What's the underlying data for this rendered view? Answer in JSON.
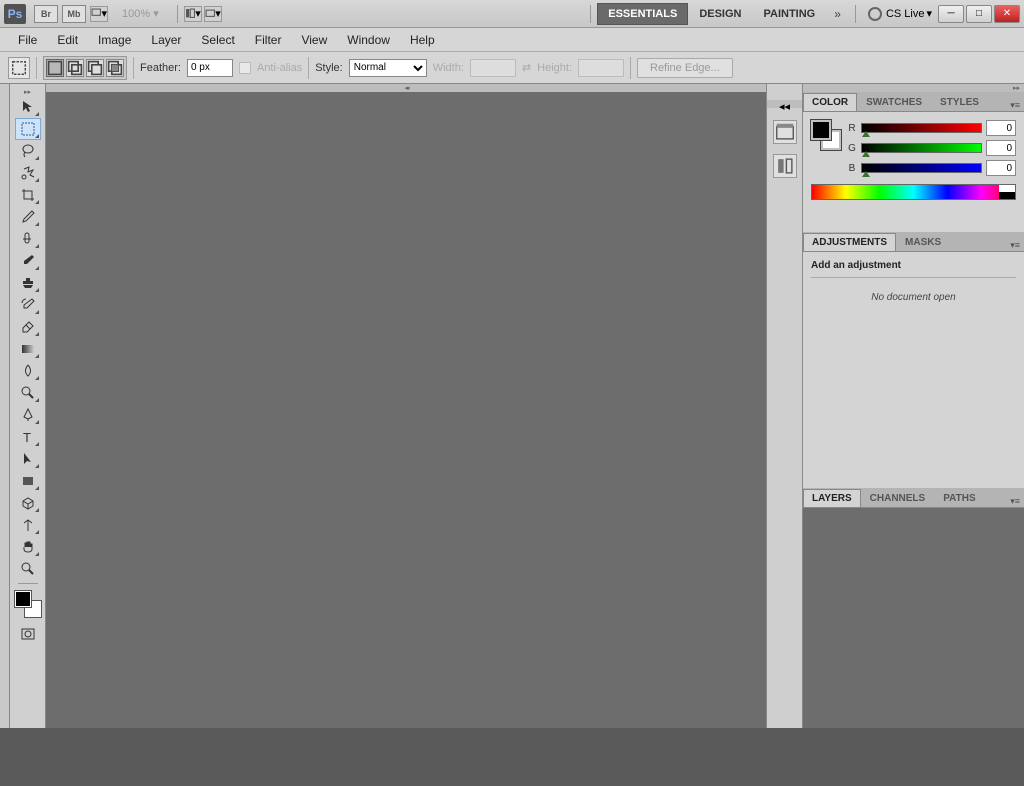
{
  "app": {
    "logo": "Ps",
    "br": "Br",
    "mb": "Mb",
    "zoom": "100%"
  },
  "workspaces": {
    "essentials": "ESSENTIALS",
    "design": "DESIGN",
    "painting": "PAINTING"
  },
  "cslive": "CS Live",
  "menu": {
    "file": "File",
    "edit": "Edit",
    "image": "Image",
    "layer": "Layer",
    "select": "Select",
    "filter": "Filter",
    "view": "View",
    "window": "Window",
    "help": "Help"
  },
  "options": {
    "feather_label": "Feather:",
    "feather_value": "0 px",
    "antialias": "Anti-alias",
    "style_label": "Style:",
    "style_value": "Normal",
    "width_label": "Width:",
    "height_label": "Height:",
    "refine": "Refine Edge..."
  },
  "color_panel": {
    "tabs": {
      "color": "COLOR",
      "swatches": "SWATCHES",
      "styles": "STYLES"
    },
    "r": "R",
    "g": "G",
    "b": "B",
    "r_val": "0",
    "g_val": "0",
    "b_val": "0"
  },
  "adjust_panel": {
    "tabs": {
      "adjustments": "ADJUSTMENTS",
      "masks": "MASKS"
    },
    "title": "Add an adjustment",
    "no_doc": "No document open"
  },
  "layers_panel": {
    "tabs": {
      "layers": "LAYERS",
      "channels": "CHANNELS",
      "paths": "PATHS"
    }
  }
}
